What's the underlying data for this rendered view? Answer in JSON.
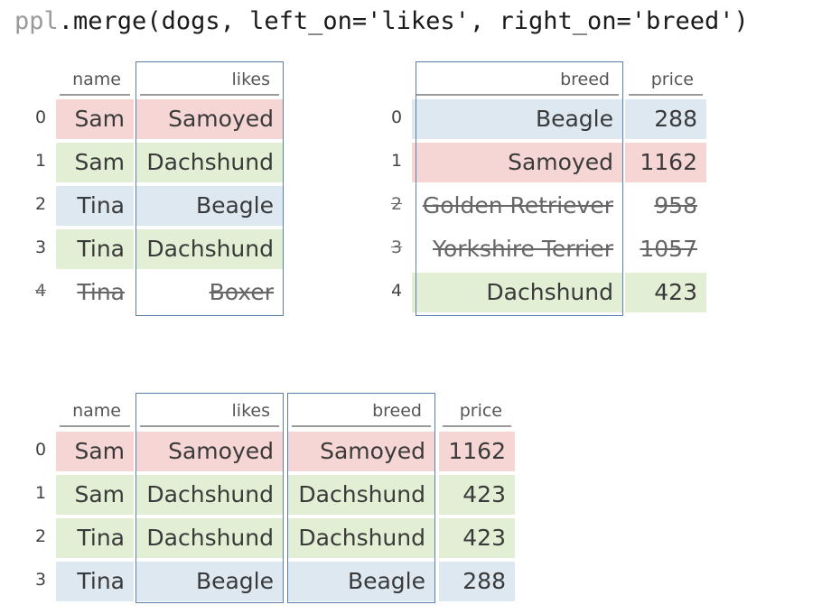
{
  "code": {
    "object": "ppl",
    "call": ".merge(dogs, left_on='likes', right_on='breed')"
  },
  "left_table": {
    "headers": {
      "name": "name",
      "likes": "likes"
    },
    "rows": [
      {
        "index": "0",
        "name": "Sam",
        "likes": "Samoyed",
        "color": "red"
      },
      {
        "index": "1",
        "name": "Sam",
        "likes": "Dachshund",
        "color": "green"
      },
      {
        "index": "2",
        "name": "Tina",
        "likes": "Beagle",
        "color": "blue"
      },
      {
        "index": "3",
        "name": "Tina",
        "likes": "Dachshund",
        "color": "green"
      },
      {
        "index": "4",
        "name": "Tina",
        "likes": "Boxer",
        "struck": true
      }
    ]
  },
  "right_table": {
    "headers": {
      "breed": "breed",
      "price": "price"
    },
    "rows": [
      {
        "index": "0",
        "breed": "Beagle",
        "price": "288",
        "color": "blue"
      },
      {
        "index": "1",
        "breed": "Samoyed",
        "price": "1162",
        "color": "red"
      },
      {
        "index": "2",
        "breed": "Golden Retriever",
        "price": "958",
        "struck": true
      },
      {
        "index": "3",
        "breed": "Yorkshire Terrier",
        "price": "1057",
        "struck": true
      },
      {
        "index": "4",
        "breed": "Dachshund",
        "price": "423",
        "color": "green"
      }
    ]
  },
  "result_table": {
    "headers": {
      "name": "name",
      "likes": "likes",
      "breed": "breed",
      "price": "price"
    },
    "rows": [
      {
        "index": "0",
        "name": "Sam",
        "likes": "Samoyed",
        "breed": "Samoyed",
        "price": "1162",
        "color": "red"
      },
      {
        "index": "1",
        "name": "Sam",
        "likes": "Dachshund",
        "breed": "Dachshund",
        "price": "423",
        "color": "green"
      },
      {
        "index": "2",
        "name": "Tina",
        "likes": "Dachshund",
        "breed": "Dachshund",
        "price": "423",
        "color": "green"
      },
      {
        "index": "3",
        "name": "Tina",
        "likes": "Beagle",
        "breed": "Beagle",
        "price": "288",
        "color": "blue"
      }
    ]
  },
  "colors": {
    "red": "#f6d6d5",
    "green": "#e2efd5",
    "blue": "#dde8f1",
    "frame": "#5b7fa8"
  }
}
